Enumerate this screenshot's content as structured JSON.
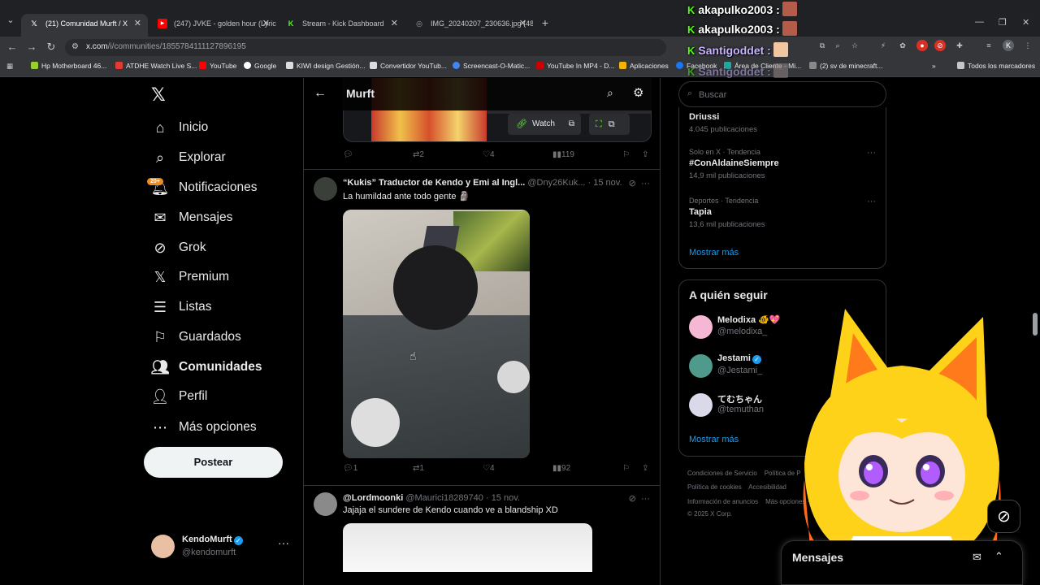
{
  "browser": {
    "tabs": [
      {
        "title": "(21) Comunidad Murft / X",
        "favicon": "X",
        "color": "#ffffff"
      },
      {
        "title": "(247) JVKE - golden hour (Lyric",
        "favicon": "▶",
        "color": "#ff0000"
      },
      {
        "title": "Stream - Kick Dashboard",
        "favicon": "K",
        "color": "#53fc18"
      },
      {
        "title": "IMG_20240207_230636.jpg (48",
        "favicon": "◎",
        "color": "#9aa0a6"
      }
    ],
    "url_domain": "x.com",
    "url_path": "/i/communities/1855784111127896195",
    "bookmarks": [
      "Hp Motherboard 46...",
      "ATDHE Watch Live S...",
      "YouTube",
      "Google",
      "KIWI design Gestión...",
      "Convertidor YouTub...",
      "Screencast-O-Matic...",
      "YouTube In MP4 - D...",
      "Aplicaciones",
      "Facebook",
      "Área de Cliente - Mi...",
      "(2) sv de minecraft...",
      "»",
      "Todos los marcadores"
    ]
  },
  "chat": [
    {
      "user": "akapulko2003 :"
    },
    {
      "user": "akapulko2003 :"
    },
    {
      "user": "Santigoddet :"
    },
    {
      "user": "Santigoddet :"
    }
  ],
  "nav": {
    "items": [
      "Inicio",
      "Explorar",
      "Notificaciones",
      "Mensajes",
      "Grok",
      "Premium",
      "Listas",
      "Guardados",
      "Comunidades",
      "Perfil",
      "Más opciones"
    ],
    "badge": "20+",
    "post_button": "Postear",
    "account": {
      "name": "KendoMurft",
      "handle": "@kendomurft"
    }
  },
  "main": {
    "title": "Murft",
    "embed": {
      "watch_label": "Watch"
    },
    "post0_actions": {
      "replies": "",
      "reposts": "2",
      "likes": "4",
      "views": "119"
    },
    "post1": {
      "author": "“Kukis” Traductor de Kendo y Emi al Ingl...",
      "handle": "@Dny26Kuk...",
      "date": "· 15 nov.",
      "text": "La humildad ante todo gente 🗿",
      "replies": "1",
      "reposts": "1",
      "likes": "4",
      "views": "92"
    },
    "post2": {
      "author": "@Lordmoonki",
      "handle": "@Maurici18289740",
      "date": "· 15 nov.",
      "text": "Jajaja el sundere de Kendo cuando ve a blandship XD"
    }
  },
  "right": {
    "search_placeholder": "Buscar",
    "trends": [
      {
        "meta": "",
        "name": "Driussi",
        "count": "4.045 publicaciones"
      },
      {
        "meta": "Solo en X · Tendencia",
        "name": "#ConAldaineSiempre",
        "count": "14,9 mil publicaciones"
      },
      {
        "meta": "Deportes · Tendencia",
        "name": "Tapia",
        "count": "13,6 mil publicaciones"
      }
    ],
    "show_more": "Mostrar más",
    "who_to_follow": {
      "title": "A quién seguir",
      "users": [
        {
          "name": "Melodixa 🐠💖",
          "handle": "@melodixa_",
          "color": "#f4b8d4"
        },
        {
          "name": "Jestami",
          "handle": "@Jestami_",
          "color": "#4f9a8a"
        },
        {
          "name": "てむちゃん",
          "handle": "@temuthan",
          "color": "#d9d9ea"
        }
      ],
      "show_more": "Mostrar más"
    },
    "footer": [
      "Condiciones de Servicio",
      "Política de P",
      "Política de cookies",
      "Accesibilidad",
      "Información de anuncios",
      "Más opciones ···",
      "© 2025 X Corp."
    ]
  },
  "messages": {
    "title": "Mensajes"
  }
}
